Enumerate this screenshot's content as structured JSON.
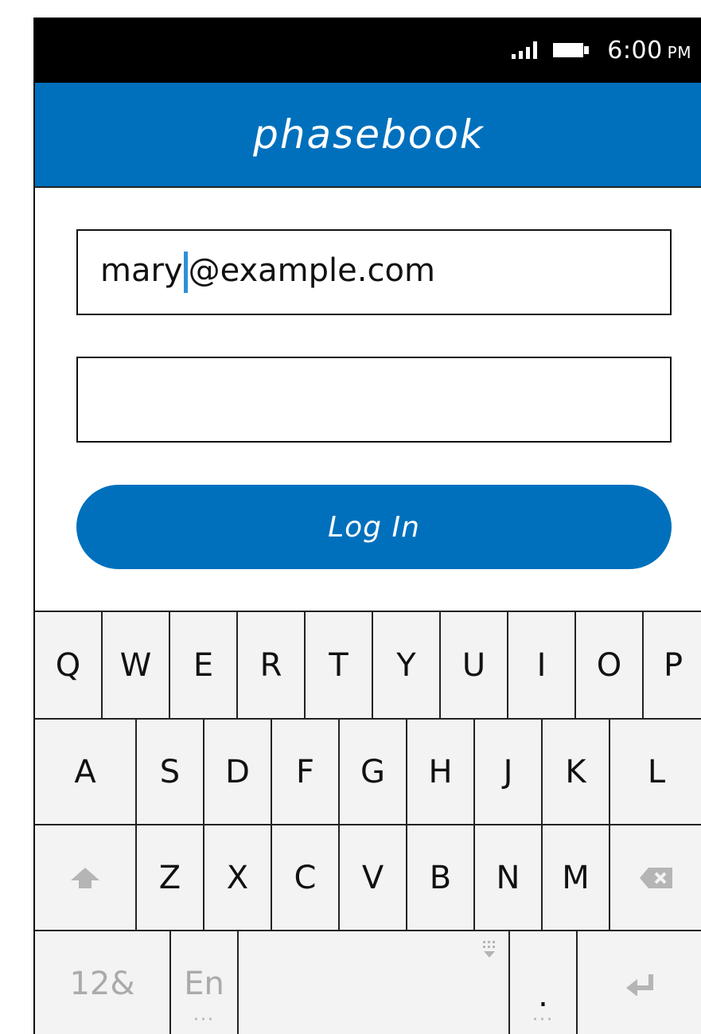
{
  "status_bar": {
    "time": "6:00",
    "ampm": "PM"
  },
  "header": {
    "title": "phasebook"
  },
  "form": {
    "email_before_caret": "mary",
    "email_after_caret": "@example.com",
    "password_value": "",
    "login_label": "Log In"
  },
  "keyboard": {
    "row1": [
      "Q",
      "W",
      "E",
      "R",
      "T",
      "Y",
      "U",
      "I",
      "O",
      "P"
    ],
    "row2": [
      "A",
      "S",
      "D",
      "F",
      "G",
      "H",
      "J",
      "K",
      "L"
    ],
    "row3": [
      "Z",
      "X",
      "C",
      "V",
      "B",
      "N",
      "M"
    ],
    "numbers_label": "12&",
    "language_label": "En",
    "period_label": "."
  },
  "colors": {
    "brand_blue": "#0070bd",
    "caret_blue": "#2f8fd8"
  }
}
